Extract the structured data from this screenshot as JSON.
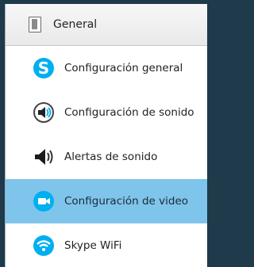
{
  "header": {
    "label": "General",
    "icon": "general-icon"
  },
  "items": [
    {
      "label": "Configuración general",
      "icon": "skype-icon"
    },
    {
      "label": "Configuración de sonido",
      "icon": "sound-settings-icon"
    },
    {
      "label": "Alertas de sonido",
      "icon": "speaker-icon"
    },
    {
      "label": "Configuración de video",
      "icon": "video-icon",
      "selected": true
    },
    {
      "label": "Skype WiFi",
      "icon": "wifi-icon"
    }
  ],
  "colors": {
    "skype_blue": "#00aff0",
    "selection": "#7fc4ea"
  }
}
